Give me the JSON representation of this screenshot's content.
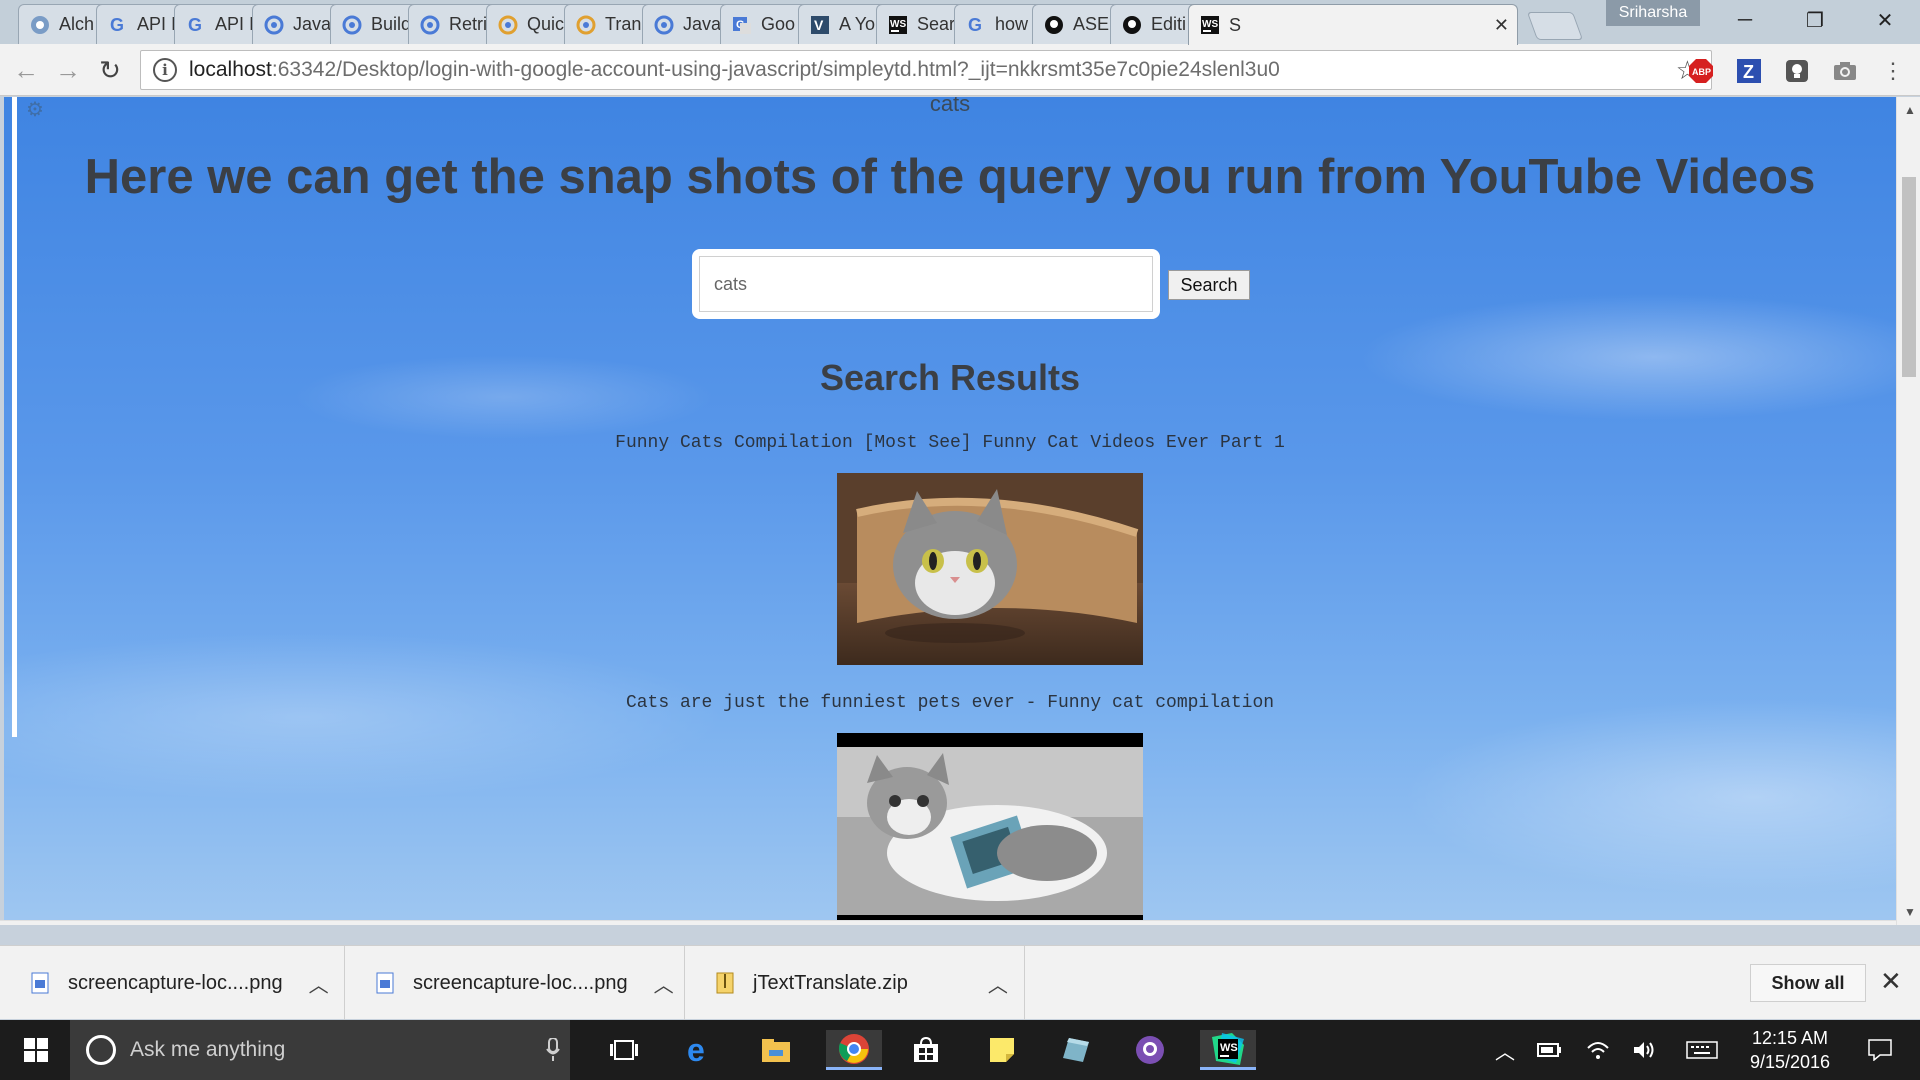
{
  "browser": {
    "tabs": [
      {
        "title": "Alch",
        "icon": "alchemy-icon"
      },
      {
        "title": "API I",
        "icon": "google-icon"
      },
      {
        "title": "API I",
        "icon": "google-icon"
      },
      {
        "title": "Java",
        "icon": "chromium-icon"
      },
      {
        "title": "Build",
        "icon": "chromium-icon"
      },
      {
        "title": "Retri",
        "icon": "chromium-icon"
      },
      {
        "title": "Quic",
        "icon": "chromium-icon"
      },
      {
        "title": "Tran",
        "icon": "chromium-icon"
      },
      {
        "title": "Java",
        "icon": "chromium-icon"
      },
      {
        "title": "Goo",
        "icon": "google-translate-icon"
      },
      {
        "title": "A Yo",
        "icon": "v-icon"
      },
      {
        "title": "Sear",
        "icon": "webstorm-icon"
      },
      {
        "title": "how",
        "icon": "google-icon"
      },
      {
        "title": "ASE",
        "icon": "github-icon"
      },
      {
        "title": "Editi",
        "icon": "github-icon"
      },
      {
        "title": "S",
        "icon": "webstorm-icon",
        "active": true
      }
    ],
    "profile_name": "Sriharsha",
    "url_host": "localhost",
    "url_rest": ":63342/Desktop/login-with-google-account-using-javascript/simpleytd.html?_ijt=nkkrsmt35e7c0pie24slenl3u0",
    "extensions": [
      {
        "name": "adblock-icon",
        "label": "ABP"
      },
      {
        "name": "zotero-icon",
        "label": "Z"
      },
      {
        "name": "bulb-extension-icon",
        "label": ""
      },
      {
        "name": "camera-extension-icon",
        "label": ""
      }
    ]
  },
  "page": {
    "top_query": "cats",
    "heading": "Here we can get the snap shots of the query you run from YouTube Videos",
    "search": {
      "value": "cats",
      "button_label": "Search"
    },
    "results_title": "Search Results",
    "results": [
      {
        "title": "Funny Cats Compilation [Most See] Funny Cat Videos Ever Part 1"
      },
      {
        "title": "Cats are just the funniest pets ever - Funny cat compilation"
      }
    ]
  },
  "downloads": {
    "items": [
      {
        "name": "screencapture-loc....png",
        "type": "png"
      },
      {
        "name": "screencapture-loc....png",
        "type": "png"
      },
      {
        "name": "jTextTranslate.zip",
        "type": "zip"
      }
    ],
    "show_all_label": "Show all"
  },
  "taskbar": {
    "search_placeholder": "Ask me anything",
    "time": "12:15 AM",
    "date": "9/15/2016"
  },
  "colors": {
    "page_sky_top": "#3f84e2",
    "page_sky_bottom": "#9fc7f1",
    "heading_text": "#3b3f45"
  }
}
